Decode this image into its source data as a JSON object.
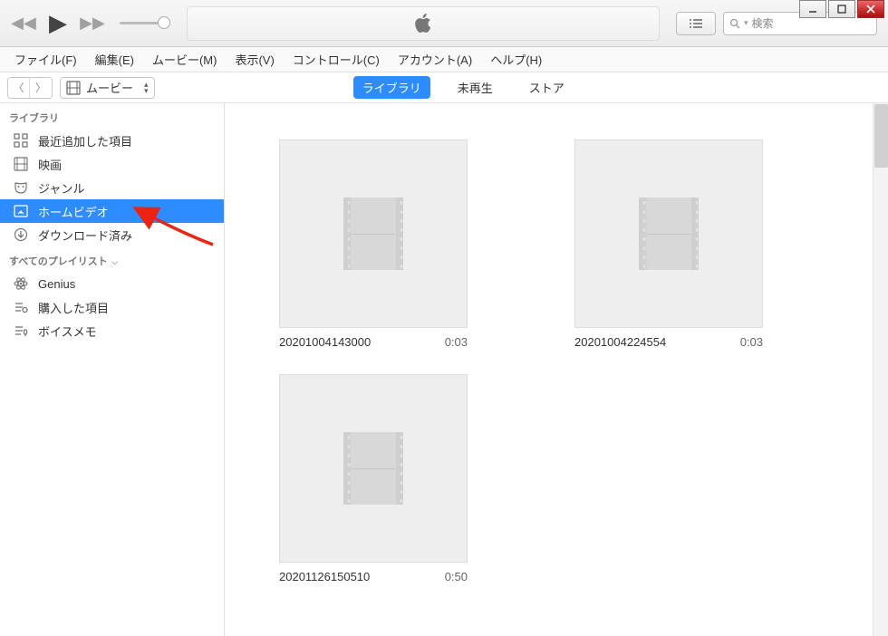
{
  "window_controls": {
    "min": "min",
    "max": "max",
    "close": "close"
  },
  "search": {
    "placeholder": "検索",
    "prefix_icon": "search"
  },
  "menubar": [
    "ファイル(F)",
    "編集(E)",
    "ムービー(M)",
    "表示(V)",
    "コントロール(C)",
    "アカウント(A)",
    "ヘルプ(H)"
  ],
  "media_selector": {
    "label": "ムービー"
  },
  "center_tabs": [
    {
      "label": "ライブラリ",
      "active": true
    },
    {
      "label": "未再生",
      "active": false
    },
    {
      "label": "ストア",
      "active": false
    }
  ],
  "sidebar": {
    "section1_title": "ライブラリ",
    "library_items": [
      {
        "icon": "grid",
        "label": "最近追加した項目"
      },
      {
        "icon": "film",
        "label": "映画"
      },
      {
        "icon": "mask",
        "label": "ジャンル"
      },
      {
        "icon": "home",
        "label": "ホームビデオ",
        "active": true
      },
      {
        "icon": "download",
        "label": "ダウンロード済み"
      }
    ],
    "section2_title": "すべてのプレイリスト",
    "playlist_items": [
      {
        "icon": "atom",
        "label": "Genius"
      },
      {
        "icon": "listcart",
        "label": "購入した項目"
      },
      {
        "icon": "listmic",
        "label": "ボイスメモ"
      }
    ]
  },
  "videos": [
    {
      "name": "20201004143000",
      "duration": "0:03"
    },
    {
      "name": "20201004224554",
      "duration": "0:03"
    },
    {
      "name": "20201126150510",
      "duration": "0:50"
    }
  ]
}
